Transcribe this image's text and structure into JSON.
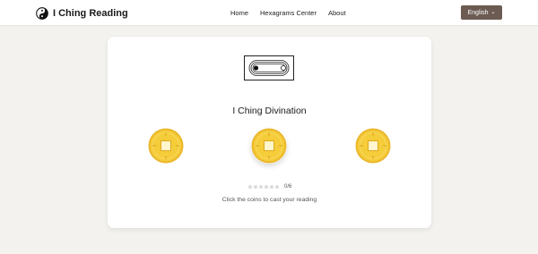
{
  "nav": {
    "brand": "I Ching Reading",
    "links": {
      "home": "Home",
      "hexagrams": "Hexagrams Center",
      "about": "About"
    },
    "language": {
      "label": "English",
      "icon": "chevron-down-icon"
    }
  },
  "main": {
    "title": "I Ching Divination",
    "coins": [
      {
        "icon": "coin-icon"
      },
      {
        "icon": "coin-icon"
      },
      {
        "icon": "coin-icon"
      }
    ],
    "progress": {
      "current": 0,
      "total": 6,
      "label": "0/6"
    },
    "hint": "Click the coins to cast your reading"
  },
  "colors": {
    "background": "#f3f2ee",
    "language_button": "#6b5b52",
    "coin_gold": "#f5cc3a",
    "coin_edge": "#eab72a"
  }
}
